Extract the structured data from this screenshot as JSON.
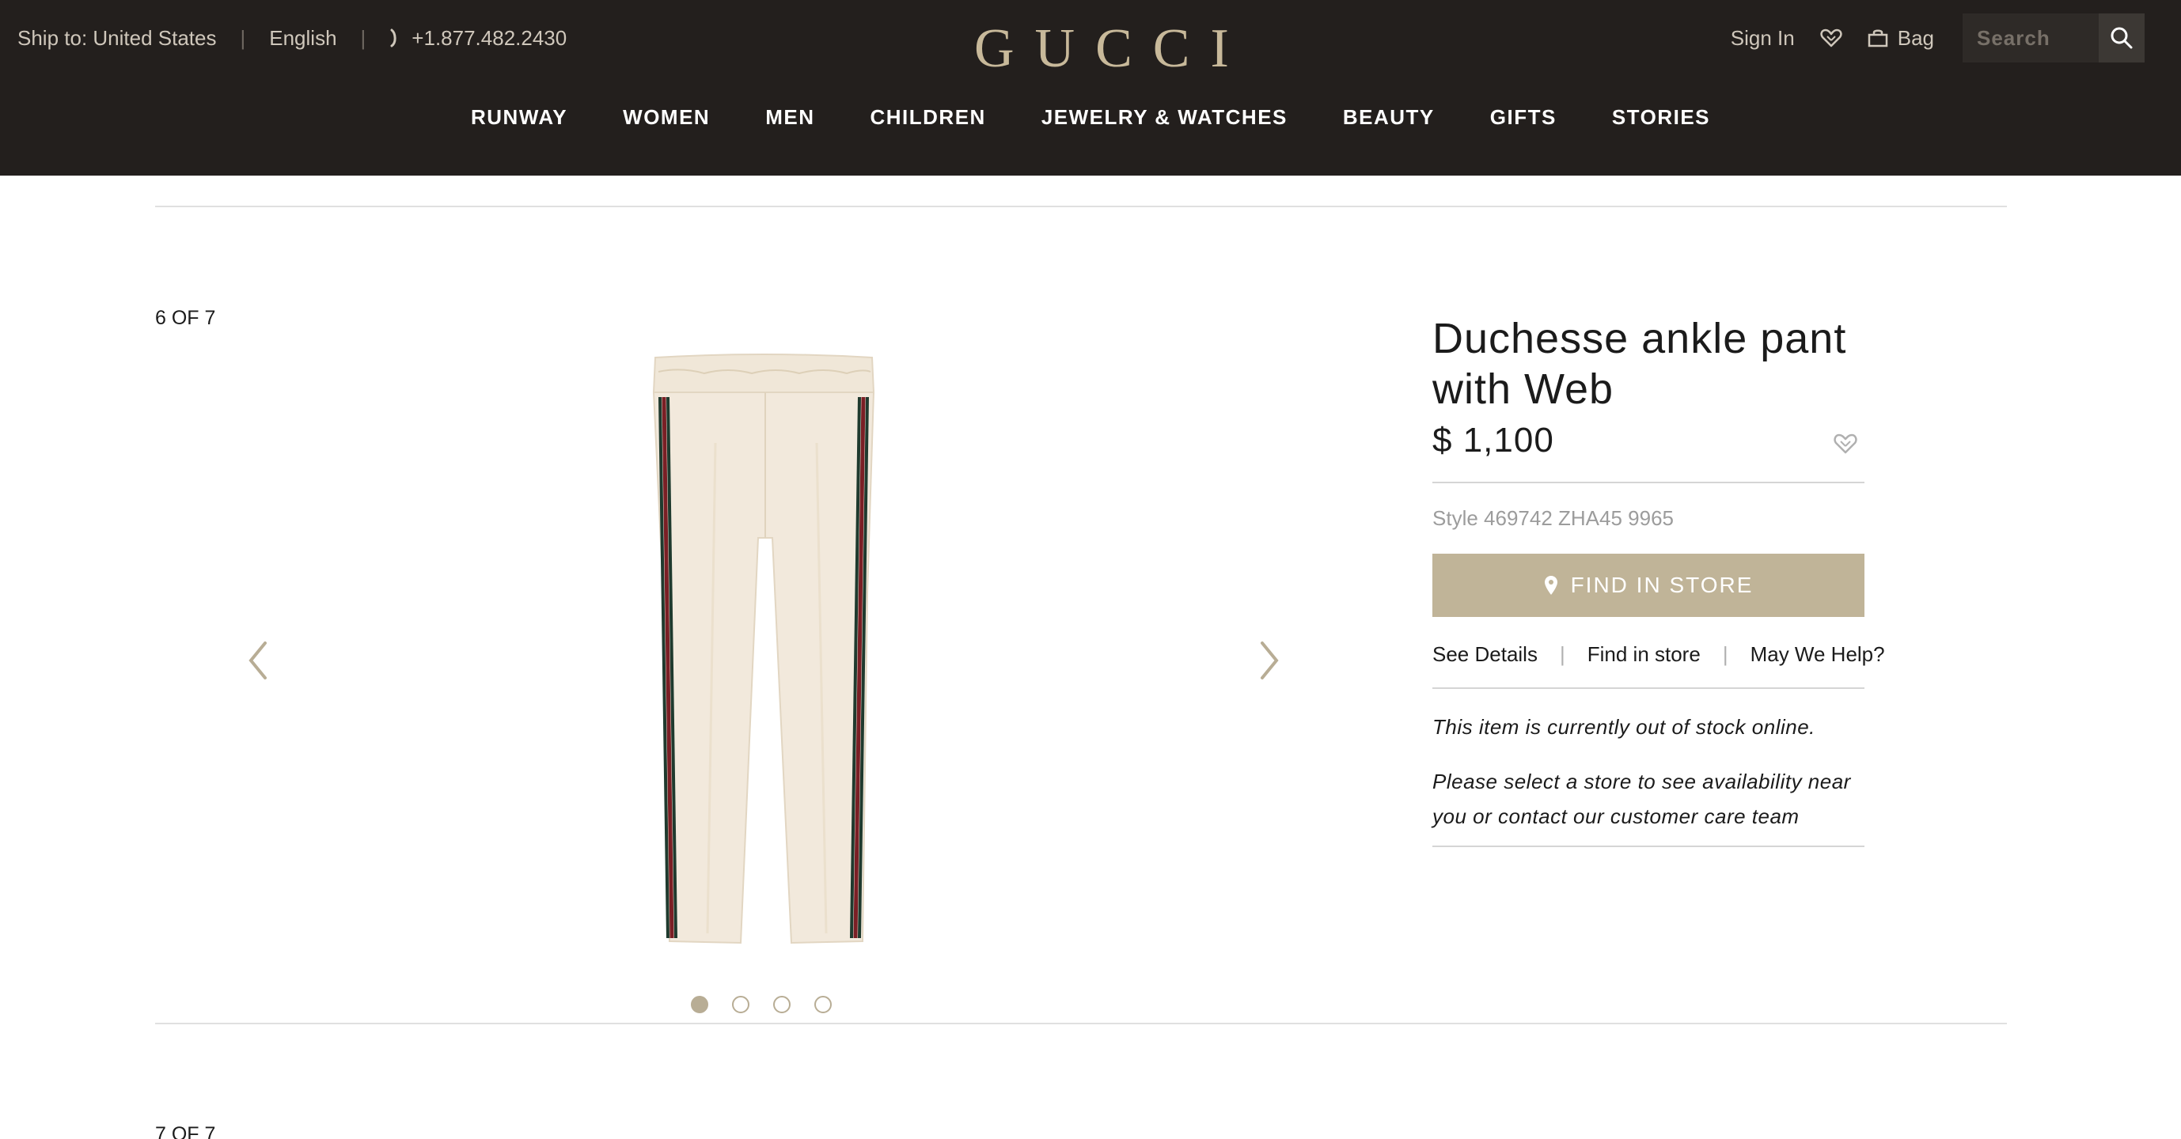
{
  "header": {
    "ship_to": "Ship to: United States",
    "language": "English",
    "phone": "+1.877.482.2430",
    "logo": "GUCCI",
    "sign_in": "Sign In",
    "bag": "Bag",
    "search_placeholder": "Search"
  },
  "nav": {
    "items": [
      "RUNWAY",
      "WOMEN",
      "MEN",
      "CHILDREN",
      "JEWELRY & WATCHES",
      "BEAUTY",
      "GIFTS",
      "STORIES"
    ]
  },
  "gallery": {
    "counter": "6 OF 7",
    "next_counter": "7 OF 7",
    "dots_total": 4,
    "active_dot": 1
  },
  "product": {
    "title": "Duchesse ankle pant with Web",
    "price": "$ 1,100",
    "style": "Style 469742 ZHA45 9965",
    "find_in_store_button": "FIND IN STORE",
    "links": {
      "see_details": "See Details",
      "find_in_store": "Find in store",
      "help": "May We Help?"
    },
    "stock_message": "This item is currently out of stock online.",
    "availability_message": "Please select a store to see availability near you or contact our customer care team"
  },
  "colors": {
    "header_bg": "#231f1d",
    "logo_gold": "#c8b99a",
    "button_tan": "#c0b498",
    "pant_cream": "#f2e9dc",
    "web_red": "#7a1f25",
    "web_green": "#1f3a2e"
  },
  "icons": {
    "phone": "phone-icon",
    "wishlist": "heart-icon",
    "bag": "bag-icon",
    "search": "search-icon",
    "prev": "chevron-left-icon",
    "next": "chevron-right-icon",
    "store": "map-pin-icon"
  }
}
